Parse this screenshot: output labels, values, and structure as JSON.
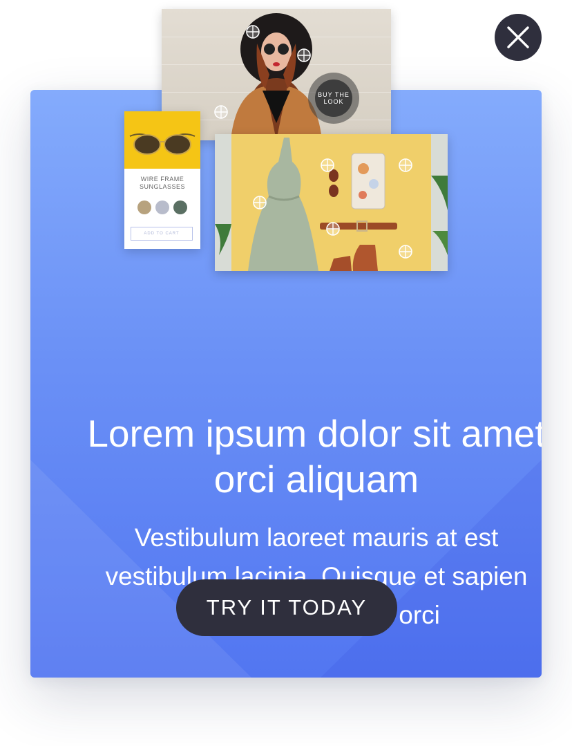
{
  "modal": {
    "headline": "Lorem ipsum dolor sit amet orci aliquam",
    "body": "Vestibulum laoreet mauris at est vestibulum lacinia. Quisque et sapien sed mi accumsan orci",
    "cta_label": "TRY IT TODAY"
  },
  "collage": {
    "buy_the_look": "BUY THE LOOK",
    "product_name": "WIRE FRAME\nSUNGLASSES",
    "add_to_cart": "ADD TO CART"
  },
  "colors": {
    "accent": "#5276f1",
    "dark_button": "#2f2f3d",
    "product_yellow": "#f5c515",
    "swatch_1": "#b7a27e",
    "swatch_2": "#b8bccb",
    "swatch_3": "#5a6f63"
  },
  "icons": {
    "close": "close-icon",
    "hotspot": "plus-circle-icon"
  }
}
